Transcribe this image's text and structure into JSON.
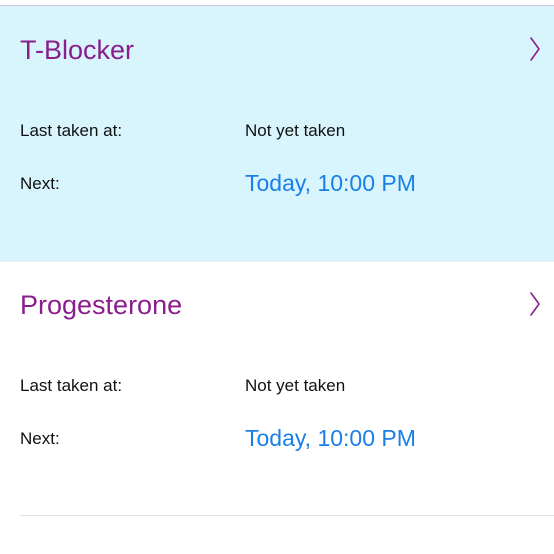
{
  "medications": [
    {
      "name": "T-Blocker",
      "last_taken_label": "Last taken at:",
      "last_taken_value": "Not yet taken",
      "next_label": "Next:",
      "next_value": "Today, 10:00 PM",
      "selected": true
    },
    {
      "name": "Progesterone",
      "last_taken_label": "Last taken at:",
      "last_taken_value": "Not yet taken",
      "next_label": "Next:",
      "next_value": "Today, 10:00 PM",
      "selected": false
    }
  ],
  "icons": {
    "disclosure": "chevron-right-icon"
  },
  "colors": {
    "selected_background": "#d8f5fd",
    "name_text": "#8a1f8c",
    "next_time_text": "#1a7fe6"
  }
}
